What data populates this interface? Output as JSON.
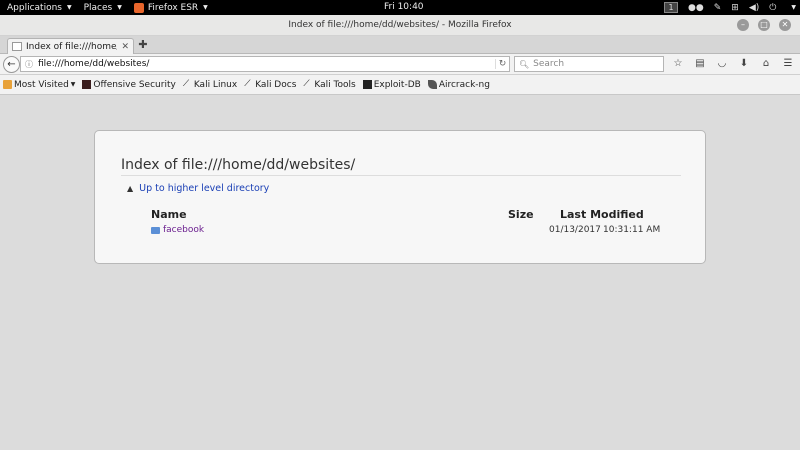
{
  "topbar": {
    "applications": "Applications",
    "places": "Places",
    "firefox": "Firefox ESR",
    "clock": "Fri 10:40",
    "workspace": "1"
  },
  "window": {
    "title": "Index of file:///home/dd/websites/ - Mozilla Firefox"
  },
  "tab": {
    "label": "Index of file:///home/..."
  },
  "navbar": {
    "url": "file:///home/dd/websites/",
    "search_placeholder": "Search"
  },
  "bookmarks": [
    {
      "label": "Most Visited",
      "icon": "folder-icon"
    },
    {
      "label": "Offensive Security",
      "icon": "offsec-icon"
    },
    {
      "label": "Kali Linux",
      "icon": "kali-dragon-icon"
    },
    {
      "label": "Kali Docs",
      "icon": "kali-dragon-icon"
    },
    {
      "label": "Kali Tools",
      "icon": "kali-dragon-icon"
    },
    {
      "label": "Exploit-DB",
      "icon": "exploitdb-icon"
    },
    {
      "label": "Aircrack-ng",
      "icon": "aircrack-icon"
    }
  ],
  "listing": {
    "heading": "Index of file:///home/dd/websites/",
    "up_link": "Up to higher level directory",
    "columns": {
      "name": "Name",
      "size": "Size",
      "modified": "Last Modified"
    },
    "rows": [
      {
        "name": "facebook",
        "size": "",
        "date": "01/13/2017",
        "time": "10:31:11 AM"
      }
    ]
  },
  "colors": {
    "link": "#1a3fb5",
    "visited_link": "#6b1f8f",
    "page_bg": "#dcdcdc",
    "card_bg": "#f7f7f7"
  }
}
